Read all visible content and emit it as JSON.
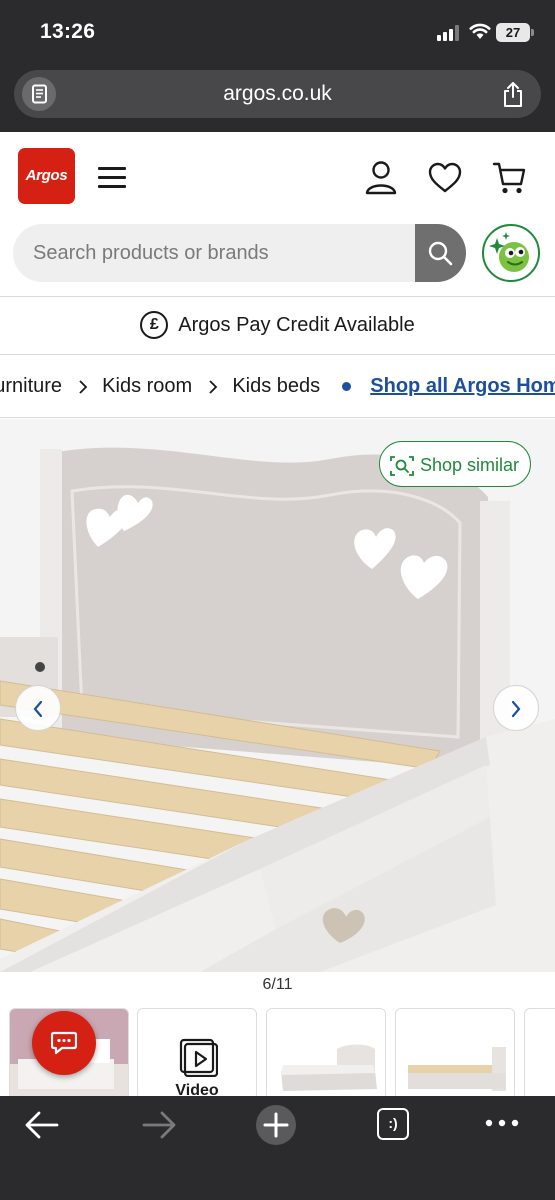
{
  "status_bar": {
    "time": "13:26",
    "battery": "27"
  },
  "browser": {
    "url": "argos.co.uk"
  },
  "header": {
    "logo_text": "Argos",
    "search_placeholder": "Search products or brands"
  },
  "credit_banner": {
    "icon_glyph": "£",
    "text": "Argos Pay Credit Available"
  },
  "breadcrumb": {
    "items": [
      "Furniture",
      "Kids room",
      "Kids beds"
    ],
    "link": "Shop all Argos Home"
  },
  "gallery": {
    "shop_similar_label": "Shop similar",
    "counter": "6/11",
    "current_image": 6,
    "total_images": 11
  },
  "thumbnails": {
    "video_label": "Video"
  },
  "colors": {
    "brand_red": "#d42114",
    "link_blue": "#1c4fa0",
    "accent_green": "#1f8a3b",
    "chrome_dark": "#2b2b2d"
  },
  "icons": {
    "header": [
      "menu-icon",
      "account-icon",
      "wishlist-heart-icon",
      "basket-icon",
      "search-icon"
    ],
    "toolbar": [
      "back-arrow-icon",
      "forward-arrow-icon",
      "new-tab-plus-icon",
      "tabs-count-icon",
      "more-dots-icon"
    ]
  },
  "toolbar": {
    "tabs_glyph": ":)"
  }
}
